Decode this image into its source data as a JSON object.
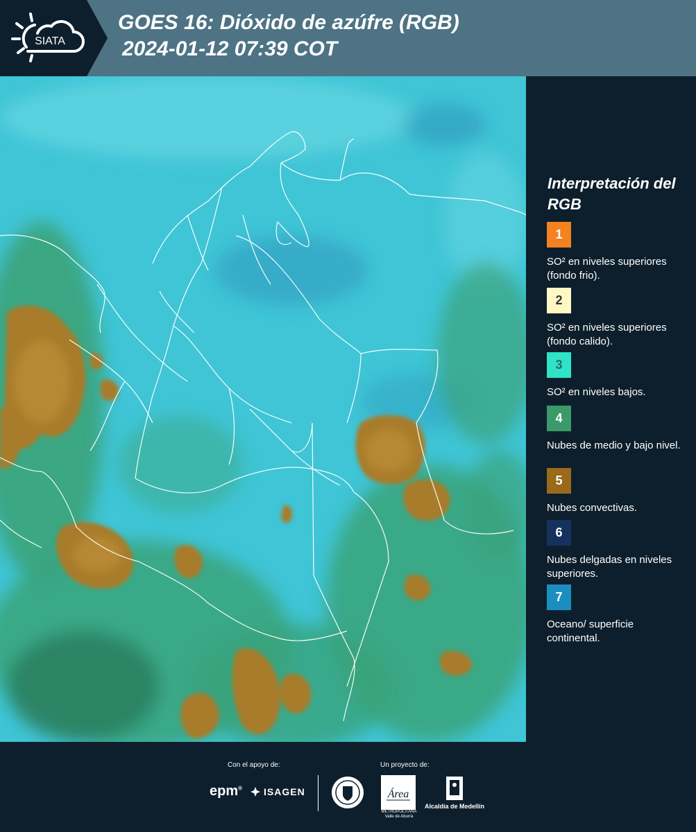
{
  "header": {
    "logo_text": "SIATA",
    "title_line1": "GOES 16: Dióxido de azúfre (RGB)",
    "title_line2": "2024-01-12 07:39 COT"
  },
  "map": {
    "label": "Satellite RGB composite map",
    "colors": {
      "base": "#3fc5d6",
      "light": "#6cd8e4",
      "dark_blue": "#2a8fb8",
      "green": "#3aa37a",
      "dark_green": "#2b7c5d",
      "convective": "#a87c2c",
      "convective_core": "#c2923a",
      "border": "#ffffff"
    }
  },
  "legend": {
    "title": "Interpretación del RGB",
    "items": [
      {
        "number": "1",
        "label": "SO² en niveles superiores (fondo frio).",
        "color": "#f58220",
        "text_color": "#ffffff"
      },
      {
        "number": "2",
        "label": "SO² en niveles superiores (fondo calido).",
        "color": "#fff7c4",
        "text_color": "#333333"
      },
      {
        "number": "3",
        "label": "SO² en niveles bajos.",
        "color": "#2fe3c8",
        "text_color": "#2a6a6a"
      },
      {
        "number": "4",
        "label": "Nubes de medio y bajo nivel.",
        "color": "#3a9a6a",
        "text_color": "#ffffff"
      },
      {
        "number": "5",
        "label": "Nubes convectivas.",
        "color": "#9a6a1a",
        "text_color": "#ffffff"
      },
      {
        "number": "6",
        "label": "Nubes delgadas en niveles superiores.",
        "color": "#15325e",
        "text_color": "#ffffff"
      },
      {
        "number": "7",
        "label": "Oceano/ superficie continental.",
        "color": "#1a8fbf",
        "text_color": "#ffffff"
      }
    ]
  },
  "footer": {
    "support_label": "Con el apoyo de:",
    "project_label": "Un proyecto de:",
    "epm": "epm",
    "isagen": "ISAGEN",
    "area_text": "METROPOLITANA Valle de Aburrá",
    "area_logo_word": "Área",
    "alcaldia": "Alcaldía de Medellín"
  }
}
